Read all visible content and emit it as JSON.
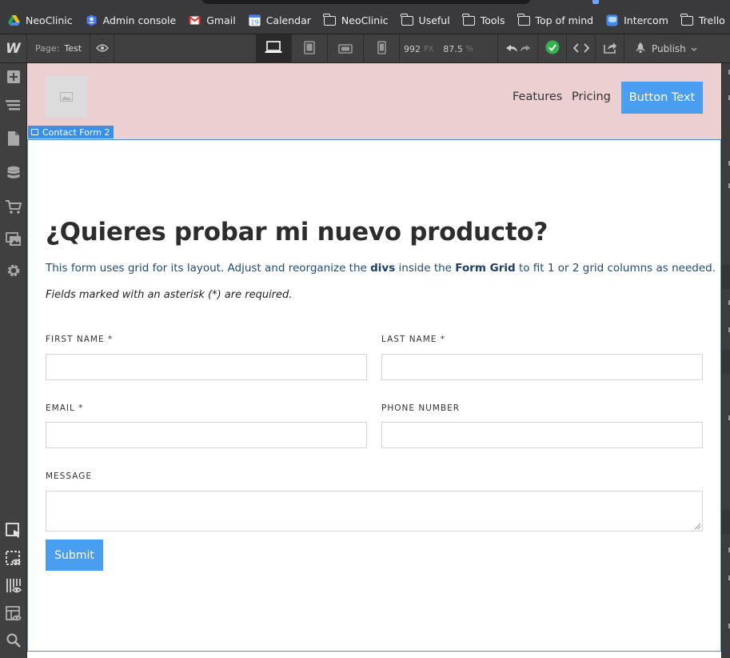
{
  "bookmarks": [
    {
      "label": "NeoClinic",
      "icon": "google-drive-icon"
    },
    {
      "label": "Admin console",
      "icon": "admin-console-icon"
    },
    {
      "label": "Gmail",
      "icon": "gmail-icon"
    },
    {
      "label": "Calendar",
      "icon": "calendar-icon",
      "badge": "19"
    },
    {
      "label": "NeoClinic",
      "icon": "folder-icon"
    },
    {
      "label": "Useful",
      "icon": "folder-icon"
    },
    {
      "label": "Tools",
      "icon": "folder-icon"
    },
    {
      "label": "Top of mind",
      "icon": "folder-icon"
    },
    {
      "label": "Intercom",
      "icon": "intercom-icon"
    },
    {
      "label": "Trello",
      "icon": "folder-icon"
    }
  ],
  "toolbar": {
    "logo": "W",
    "page_label": "Page:",
    "page_value": "Test",
    "width": "992",
    "width_unit": "PX",
    "zoom": "87.5",
    "zoom_unit": "%",
    "publish": "Publish"
  },
  "canvas": {
    "nav": {
      "links": [
        "Features",
        "Pricing"
      ],
      "button": "Button Text"
    },
    "selection_label": "Contact Form 2",
    "form": {
      "title": "¿Quieres probar mi nuevo producto?",
      "desc_prefix": "This form uses grid for its layout. Adjust and reorganize the ",
      "desc_bold1": "divs",
      "desc_mid": " inside the ",
      "desc_bold2": "Form Grid",
      "desc_suffix": " to fit 1 or 2 grid columns as needed.",
      "required_note": "Fields marked with an asterisk (*) are required.",
      "labels": {
        "first_name": "FIRST NAME *",
        "last_name": "LAST NAME *",
        "email": "EMAIL *",
        "phone": "PHONE NUMBER",
        "message": "MESSAGE"
      },
      "submit": "Submit"
    }
  },
  "colors": {
    "navbar_bg": "#eccfd1",
    "accent": "#4a9ef0",
    "selection": "#3b8fe6",
    "check_green": "#34b24f"
  }
}
